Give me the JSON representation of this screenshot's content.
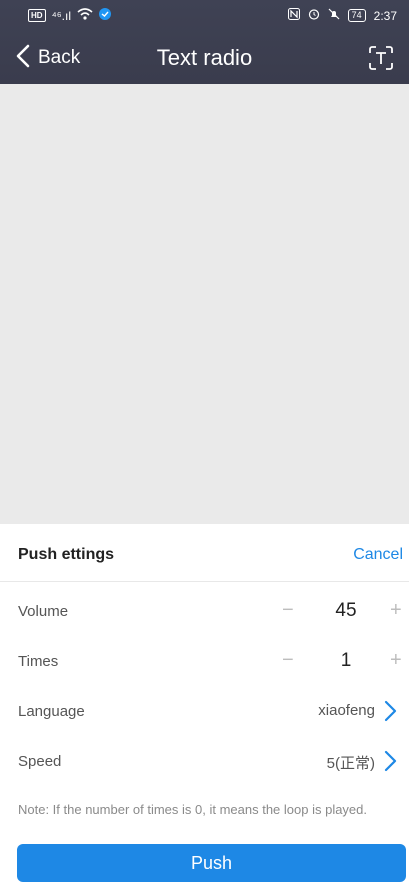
{
  "status_bar": {
    "hd": "HD",
    "signal": "⁴⁶.ıl",
    "battery": "74",
    "time": "2:37"
  },
  "header": {
    "back_label": "Back",
    "title": "Text radio"
  },
  "sheet": {
    "title": "Push ettings",
    "cancel_label": "Cancel",
    "rows": [
      {
        "label": "Volume",
        "value": "45",
        "minus": "−",
        "plus": "+"
      },
      {
        "label": "Times",
        "value": "1",
        "minus": "−",
        "plus": "+"
      },
      {
        "label": "Language",
        "value": "xiaofeng"
      },
      {
        "label": "Speed",
        "value": "5(正常)"
      }
    ],
    "note": "Note: If the number of times is 0, it means the loop is played.",
    "push_label": "Push"
  },
  "colors": {
    "accent": "#1e88e5",
    "header_bg": "#3f4254",
    "content_bg": "#eaeaea"
  },
  "icons": {
    "back": "chevron-left-icon",
    "text_mode": "text-frame-icon",
    "language_next": "chevron-right-icon",
    "speed_next": "chevron-right-icon"
  }
}
